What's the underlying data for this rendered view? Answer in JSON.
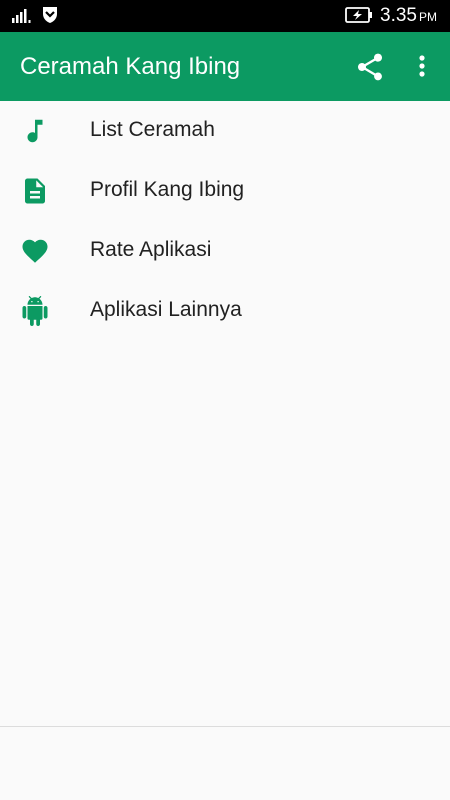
{
  "status_bar": {
    "time": "3.35",
    "ampm": "PM",
    "icons": [
      "signal-icon",
      "shield-icon",
      "battery-charging-icon"
    ]
  },
  "app_bar": {
    "title": "Ceramah Kang Ibing",
    "actions": [
      "share-icon",
      "more-vert-icon"
    ]
  },
  "colors": {
    "primary": "#0c9a62",
    "status_bar": "#000000",
    "background": "#fafafa",
    "text": "#212121"
  },
  "menu": {
    "items": [
      {
        "label": "List Ceramah",
        "icon": "music-note-icon"
      },
      {
        "label": "Profil Kang Ibing",
        "icon": "document-icon"
      },
      {
        "label": "Rate Aplikasi",
        "icon": "heart-icon"
      },
      {
        "label": "Aplikasi Lainnya",
        "icon": "android-icon"
      }
    ]
  }
}
